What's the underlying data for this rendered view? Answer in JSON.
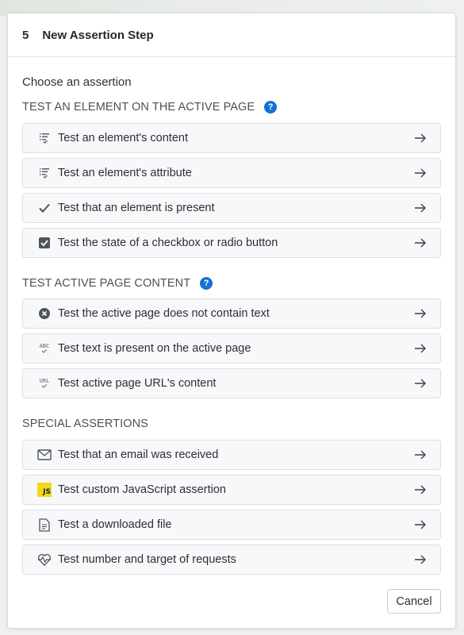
{
  "header": {
    "step_number": "5",
    "title": "New Assertion Step"
  },
  "subtitle": "Choose an assertion",
  "sections": [
    {
      "title": "TEST AN ELEMENT ON THE ACTIVE PAGE",
      "has_help": true,
      "items": [
        {
          "label": "Test an element's content",
          "icon": "filter-lines-icon"
        },
        {
          "label": "Test an element's attribute",
          "icon": "filter-lines-icon"
        },
        {
          "label": "Test that an element is present",
          "icon": "check-icon"
        },
        {
          "label": "Test the state of a checkbox or radio button",
          "icon": "checkbox-icon"
        }
      ]
    },
    {
      "title": "TEST ACTIVE PAGE CONTENT",
      "has_help": true,
      "items": [
        {
          "label": "Test the active page does not contain text",
          "icon": "circle-x-icon"
        },
        {
          "label": "Test text is present on the active page",
          "icon": "abc-icon"
        },
        {
          "label": "Test active page URL's content",
          "icon": "url-icon"
        }
      ]
    },
    {
      "title": "SPECIAL ASSERTIONS",
      "has_help": false,
      "items": [
        {
          "label": "Test that an email was received",
          "icon": "envelope-icon"
        },
        {
          "label": "Test custom JavaScript assertion",
          "icon": "javascript-icon"
        },
        {
          "label": "Test a downloaded file",
          "icon": "file-icon"
        },
        {
          "label": "Test number and target of requests",
          "icon": "heartbeat-icon"
        }
      ]
    }
  ],
  "icon_text": {
    "abc": "ABC",
    "url": "URL",
    "js": "JS",
    "help": "?"
  },
  "cancel_label": "Cancel",
  "colors": {
    "accent": "#1372d3",
    "js_badge": "#f0d91c",
    "item_bg": "#f7f8f9"
  }
}
